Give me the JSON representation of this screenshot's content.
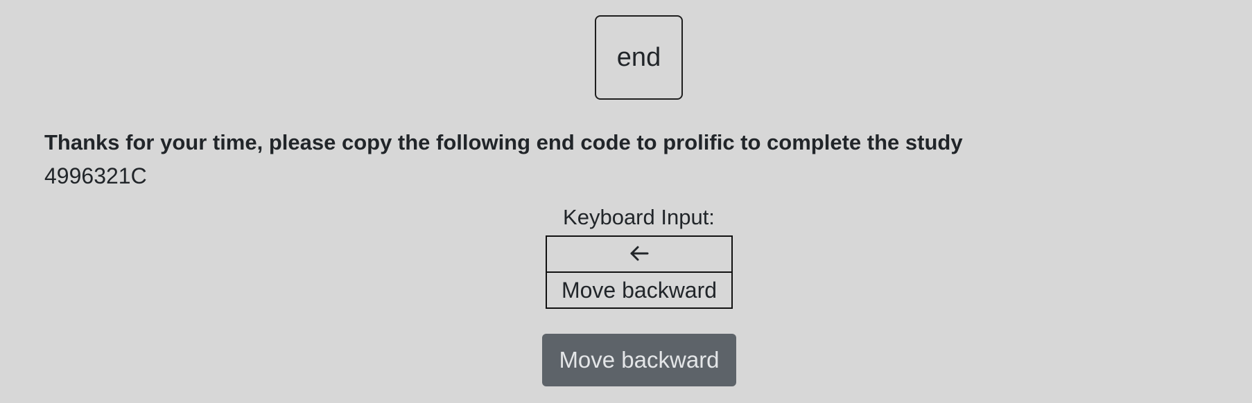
{
  "stage": {
    "label": "end"
  },
  "message": "Thanks for your time, please copy the following end code to prolific to complete the study",
  "end_code": "4996321C",
  "keyboard": {
    "label": "Keyboard Input:",
    "key_icon": "arrow-left-icon",
    "action": "Move backward"
  },
  "button": {
    "label": "Move backward"
  }
}
